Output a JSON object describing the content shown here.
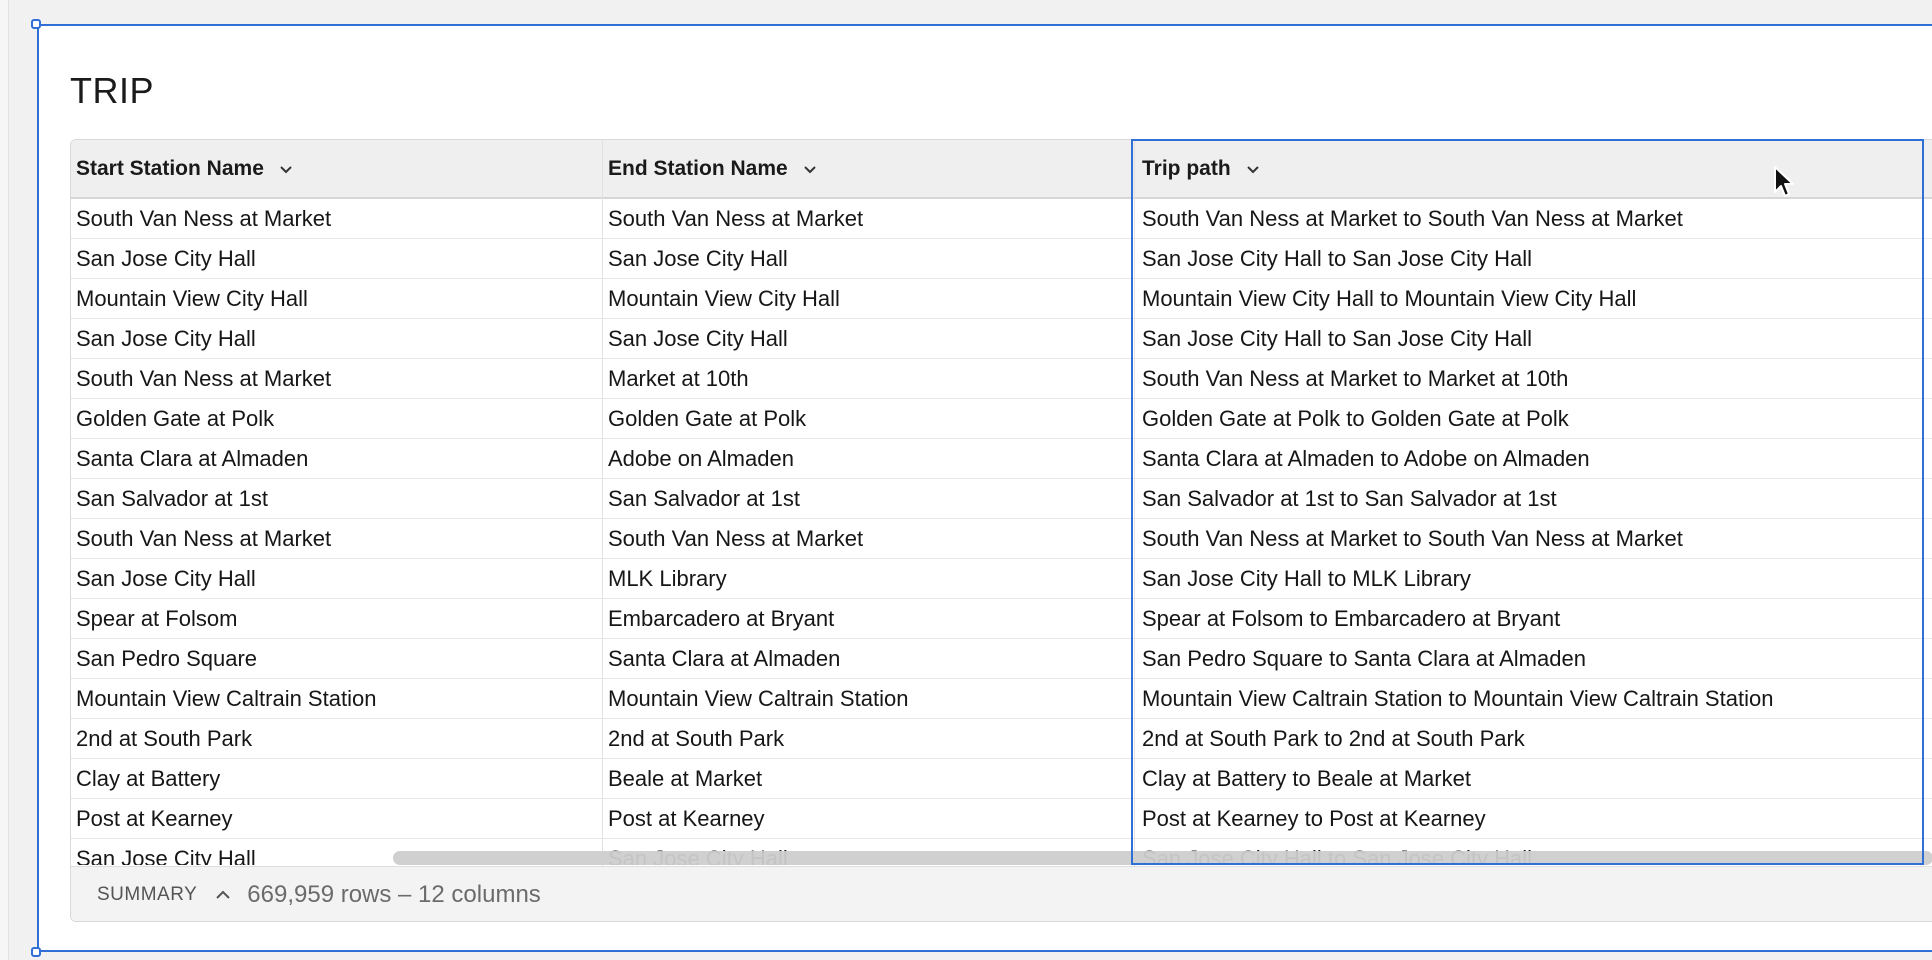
{
  "element": {
    "title": "TRIP"
  },
  "table": {
    "columns": [
      {
        "label": "Start Station Name"
      },
      {
        "label": "End Station Name"
      },
      {
        "label": "Trip path"
      }
    ],
    "rows": [
      [
        "South Van Ness at Market",
        "South Van Ness at Market",
        "South Van Ness at Market to South Van Ness at Market"
      ],
      [
        "San Jose City Hall",
        "San Jose City Hall",
        "San Jose City Hall to San Jose City Hall"
      ],
      [
        "Mountain View City Hall",
        "Mountain View City Hall",
        "Mountain View City Hall to Mountain View City Hall"
      ],
      [
        "San Jose City Hall",
        "San Jose City Hall",
        "San Jose City Hall to San Jose City Hall"
      ],
      [
        "South Van Ness at Market",
        "Market at 10th",
        "South Van Ness at Market to Market at 10th"
      ],
      [
        "Golden Gate at Polk",
        "Golden Gate at Polk",
        "Golden Gate at Polk to Golden Gate at Polk"
      ],
      [
        "Santa Clara at Almaden",
        "Adobe on Almaden",
        "Santa Clara at Almaden to Adobe on Almaden"
      ],
      [
        "San Salvador at 1st",
        "San Salvador at 1st",
        "San Salvador at 1st to San Salvador at 1st"
      ],
      [
        "South Van Ness at Market",
        "South Van Ness at Market",
        "South Van Ness at Market to South Van Ness at Market"
      ],
      [
        "San Jose City Hall",
        "MLK Library",
        "San Jose City Hall to MLK Library"
      ],
      [
        "Spear at Folsom",
        "Embarcadero at Bryant",
        "Spear at Folsom to Embarcadero at Bryant"
      ],
      [
        "San Pedro Square",
        "Santa Clara at Almaden",
        "San Pedro Square to Santa Clara at Almaden"
      ],
      [
        "Mountain View Caltrain Station",
        "Mountain View Caltrain Station",
        "Mountain View Caltrain Station to Mountain View Caltrain Station"
      ],
      [
        "2nd at South Park",
        "2nd at South Park",
        "2nd at South Park to 2nd at South Park"
      ],
      [
        "Clay at Battery",
        "Beale at Market",
        "Clay at Battery to Beale at Market"
      ],
      [
        "Post at Kearney",
        "Post at Kearney",
        "Post at Kearney to Post at Kearney"
      ],
      [
        "San Jose City Hall",
        "San Jose City Hall",
        "San Jose City Hall to San Jose City Hall"
      ]
    ]
  },
  "summary": {
    "label": "SUMMARY",
    "count": "669,959 rows – 12 columns"
  },
  "colors": {
    "selection": "#2f6fd6",
    "header_bg": "#efefef",
    "summary_bg": "#f3f3f3"
  },
  "icons": {
    "column_menu": "chevron-down-icon",
    "summary_toggle": "chevron-up-icon",
    "cursor": "mouse-pointer-icon"
  }
}
